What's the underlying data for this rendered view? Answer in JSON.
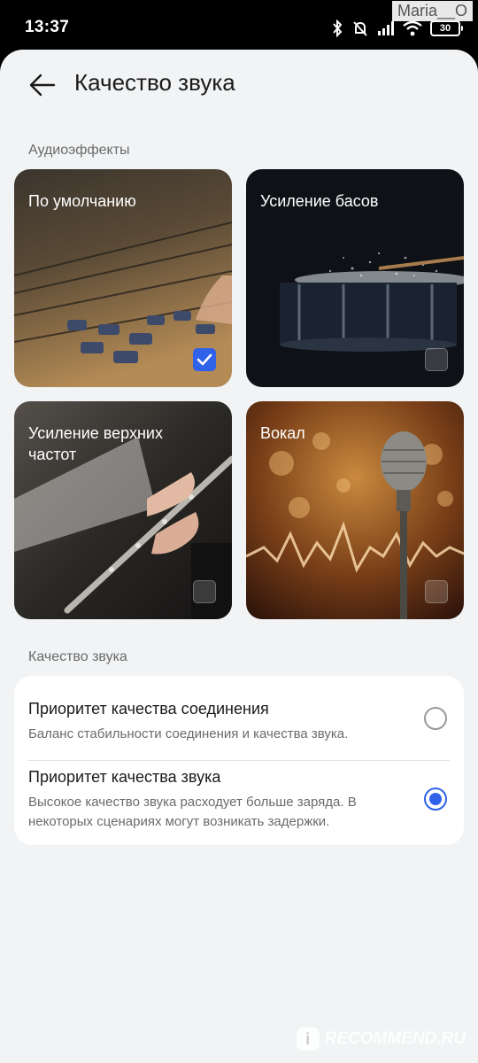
{
  "status": {
    "time": "13:37",
    "battery": "30",
    "username": "Maria__O"
  },
  "header": {
    "title": "Качество звука"
  },
  "effects": {
    "section_label": "Аудиоэффекты",
    "cards": [
      {
        "label": "По умолчанию",
        "selected": true
      },
      {
        "label": "Усиление басов",
        "selected": false
      },
      {
        "label": "Усиление верхних частот",
        "selected": false
      },
      {
        "label": "Вокал",
        "selected": false
      }
    ]
  },
  "quality": {
    "section_label": "Качество звука",
    "options": [
      {
        "title": "Приоритет качества соединения",
        "description": "Баланс стабильности соединения и качества звука.",
        "selected": false
      },
      {
        "title": "Приоритет качества звука",
        "description": "Высокое качество звука расходует больше заряда. В некоторых сценариях могут возникать задержки.",
        "selected": true
      }
    ]
  },
  "watermark": {
    "text": "RECOMMEND.RU"
  },
  "colors": {
    "accent": "#2f62e8",
    "background": "#f1f3f5"
  }
}
